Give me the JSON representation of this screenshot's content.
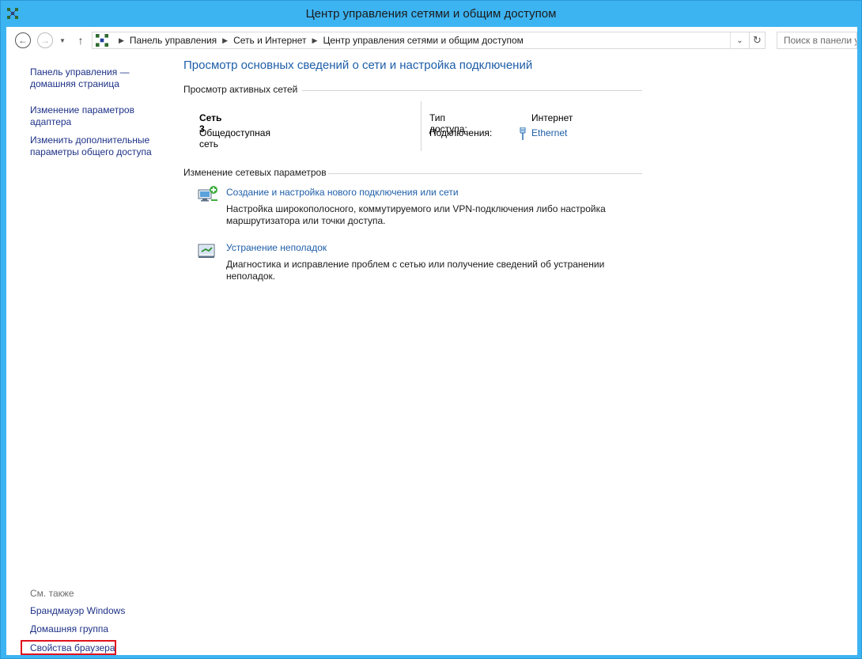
{
  "window": {
    "title": "Центр управления сетями и общим доступом"
  },
  "nav": {
    "breadcrumbs": [
      "Панель управления",
      "Сеть и Интернет",
      "Центр управления сетями и общим доступом"
    ],
    "search_placeholder": "Поиск в панели у"
  },
  "sidebar": {
    "links": [
      {
        "line1": "Панель управления —",
        "line2": "домашняя страница"
      },
      {
        "line1": "Изменение параметров",
        "line2": "адаптера"
      },
      {
        "line1": "Изменить дополнительные",
        "line2": "параметры общего доступа"
      }
    ],
    "see_also_label": "См. также",
    "see_also_links": [
      "Брандмауэр Windows",
      "Домашняя группа",
      "Свойства браузера"
    ]
  },
  "main": {
    "title": "Просмотр основных сведений о сети и настройка подключений",
    "active_networks_header": "Просмотр активных сетей",
    "network": {
      "name": "Сеть  3",
      "type": "Общедоступная сеть",
      "access_label": "Тип доступа:",
      "access_value": "Интернет",
      "connections_label": "Подключения:",
      "connections_value": "Ethernet"
    },
    "change_settings_header": "Изменение сетевых параметров",
    "tasks": [
      {
        "link": "Создание и настройка нового подключения или сети",
        "desc_line1": "Настройка широкополосного, коммутируемого или VPN-подключения либо настройка",
        "desc_line2": "маршрутизатора или точки доступа."
      },
      {
        "link": "Устранение неполадок",
        "desc_line1": "Диагностика и исправление проблем с сетью или получение сведений об устранении",
        "desc_line2": "неполадок."
      }
    ]
  },
  "colors": {
    "frame": "#3db4f2",
    "link": "#1e5ea8",
    "sidebar_link": "#1e3287",
    "highlight": "#e0121d"
  }
}
